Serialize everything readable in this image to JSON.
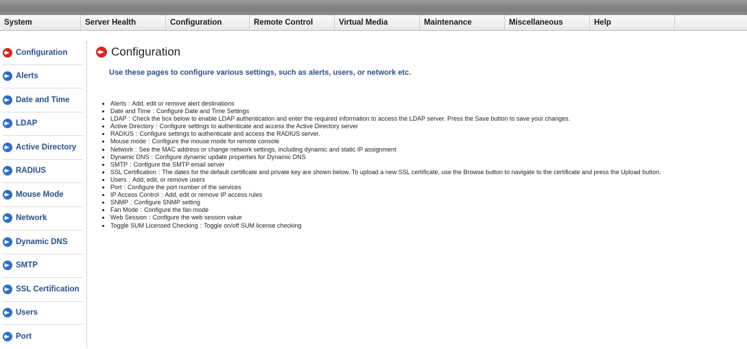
{
  "menu": [
    {
      "label": "System"
    },
    {
      "label": "Server Health"
    },
    {
      "label": "Configuration"
    },
    {
      "label": "Remote Control"
    },
    {
      "label": "Virtual Media"
    },
    {
      "label": "Maintenance"
    },
    {
      "label": "Miscellaneous"
    },
    {
      "label": "Help"
    }
  ],
  "sidebar": {
    "items": [
      {
        "label": "Configuration",
        "icon": "arrow-circle-red-icon",
        "active": true
      },
      {
        "label": "Alerts",
        "icon": "arrow-circle-blue-icon"
      },
      {
        "label": "Date and Time",
        "icon": "arrow-circle-blue-icon"
      },
      {
        "label": "LDAP",
        "icon": "arrow-circle-blue-icon"
      },
      {
        "label": "Active Directory",
        "icon": "arrow-circle-blue-icon"
      },
      {
        "label": "RADIUS",
        "icon": "arrow-circle-blue-icon"
      },
      {
        "label": "Mouse Mode",
        "icon": "arrow-circle-blue-icon"
      },
      {
        "label": "Network",
        "icon": "arrow-circle-blue-icon"
      },
      {
        "label": "Dynamic DNS",
        "icon": "arrow-circle-blue-icon"
      },
      {
        "label": "SMTP",
        "icon": "arrow-circle-blue-icon"
      },
      {
        "label": "SSL Certification",
        "icon": "arrow-circle-blue-icon"
      },
      {
        "label": "Users",
        "icon": "arrow-circle-blue-icon"
      },
      {
        "label": "Port",
        "icon": "arrow-circle-blue-icon"
      }
    ]
  },
  "main": {
    "title": "Configuration",
    "intro": "Use these pages to configure various settings, such as alerts, users, or network etc.",
    "descriptions": [
      {
        "name": "Alerts",
        "text": "Add, edit or remove alert destinations"
      },
      {
        "name": "Date and Time",
        "text": "Configure Date and Time Settings"
      },
      {
        "name": "LDAP",
        "text": "Check the box below to enable LDAP authentication and enter the required information to access the LDAP server. Press the Save button to save your changes."
      },
      {
        "name": "Active Directory",
        "text": "Configure settings to authenticate and access the Active Directory server"
      },
      {
        "name": "RADIUS",
        "text": "Configure settings to authenticate and access the RADIUS server."
      },
      {
        "name": "Mouse mode",
        "text": "Configure the mouse mode for remote console"
      },
      {
        "name": "Network",
        "text": "See the MAC address or change network settings, including dynamic and static IP assignment"
      },
      {
        "name": "Dynamic DNS",
        "text": "Configure dynamic update properties for Dynamic DNS"
      },
      {
        "name": "SMTP",
        "text": "Configure the SMTP email server"
      },
      {
        "name": "SSL Certification",
        "text": "The dates for the default certificate and private key are shown below. To upload a new SSL certificate, use the Browse button to navigate to the certificate and press the Upload button."
      },
      {
        "name": "Users",
        "text": "Add, edit, or remove users"
      },
      {
        "name": "Port",
        "text": "Configure the port number of the services"
      },
      {
        "name": "IP Access Control",
        "text": "Add, edit or remove IP access rules"
      },
      {
        "name": "SNMP",
        "text": "Configure SNMP setting"
      },
      {
        "name": "Fan Mode",
        "text": "Configure the fan mode"
      },
      {
        "name": "Web Session",
        "text": "Configure the web session value"
      },
      {
        "name": "Toggle SUM Licensed Checking",
        "text": "Toggle on/off SUM license checking"
      }
    ],
    "separator": ":"
  },
  "colors": {
    "accent_blue": "#2f6fc4",
    "active_red": "#d8261f",
    "link_text": "#2a4f8a"
  }
}
